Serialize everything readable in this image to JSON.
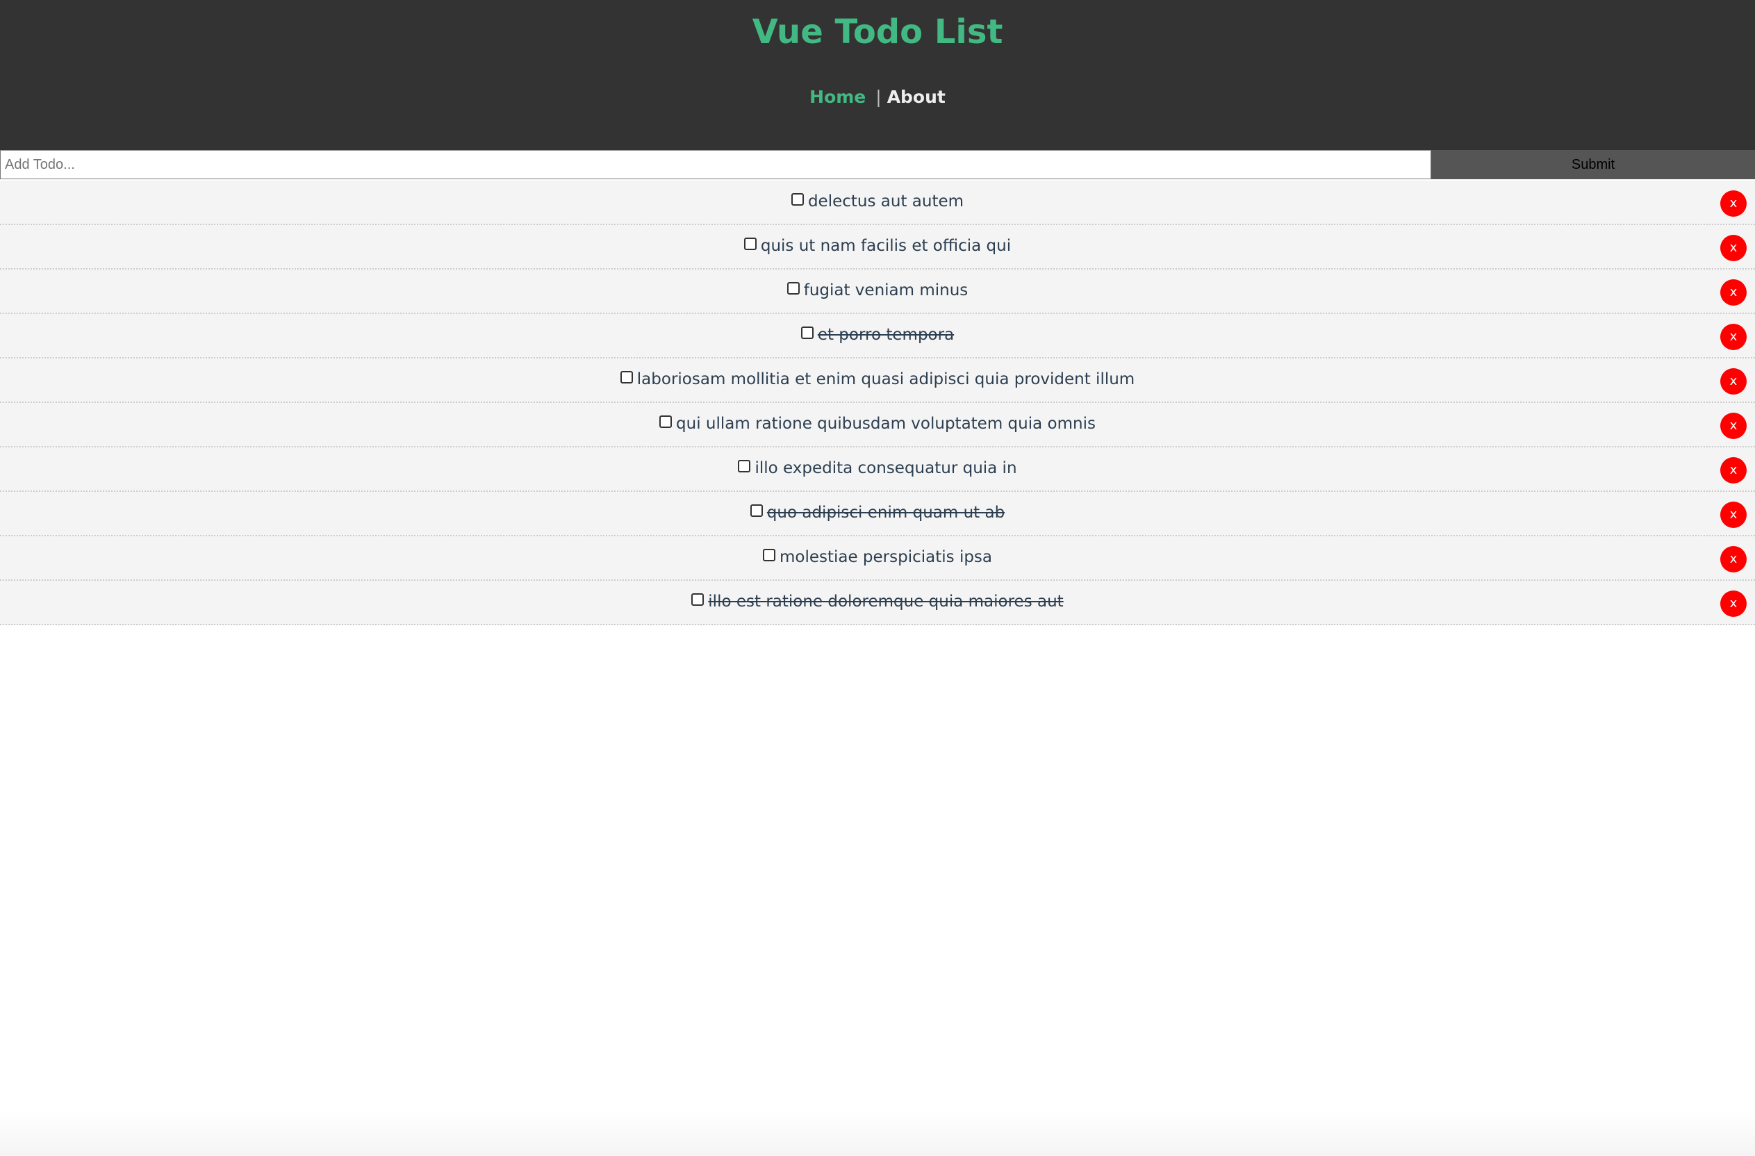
{
  "app": {
    "title": "Vue Todo List"
  },
  "nav": {
    "home": "Home",
    "separator": "|",
    "about": "About"
  },
  "add_form": {
    "placeholder": "Add Todo...",
    "value": "",
    "submit_label": "Submit"
  },
  "todos": [
    {
      "title": "delectus aut autem",
      "completed": false,
      "delete_label": "x"
    },
    {
      "title": "quis ut nam facilis et officia qui",
      "completed": false,
      "delete_label": "x"
    },
    {
      "title": "fugiat veniam minus",
      "completed": false,
      "delete_label": "x"
    },
    {
      "title": "et porro tempora",
      "completed": true,
      "delete_label": "x"
    },
    {
      "title": "laboriosam mollitia et enim quasi adipisci quia provident illum",
      "completed": false,
      "delete_label": "x"
    },
    {
      "title": "qui ullam ratione quibusdam voluptatem quia omnis",
      "completed": false,
      "delete_label": "x"
    },
    {
      "title": "illo expedita consequatur quia in",
      "completed": false,
      "delete_label": "x"
    },
    {
      "title": "quo adipisci enim quam ut ab",
      "completed": true,
      "delete_label": "x"
    },
    {
      "title": "molestiae perspiciatis ipsa",
      "completed": false,
      "delete_label": "x"
    },
    {
      "title": "illo est ratione doloremque quia maiores aut",
      "completed": true,
      "delete_label": "x"
    }
  ],
  "colors": {
    "header_bg": "#333333",
    "accent": "#42b983",
    "delete": "#ff0000",
    "row_bg": "#f4f4f4"
  }
}
